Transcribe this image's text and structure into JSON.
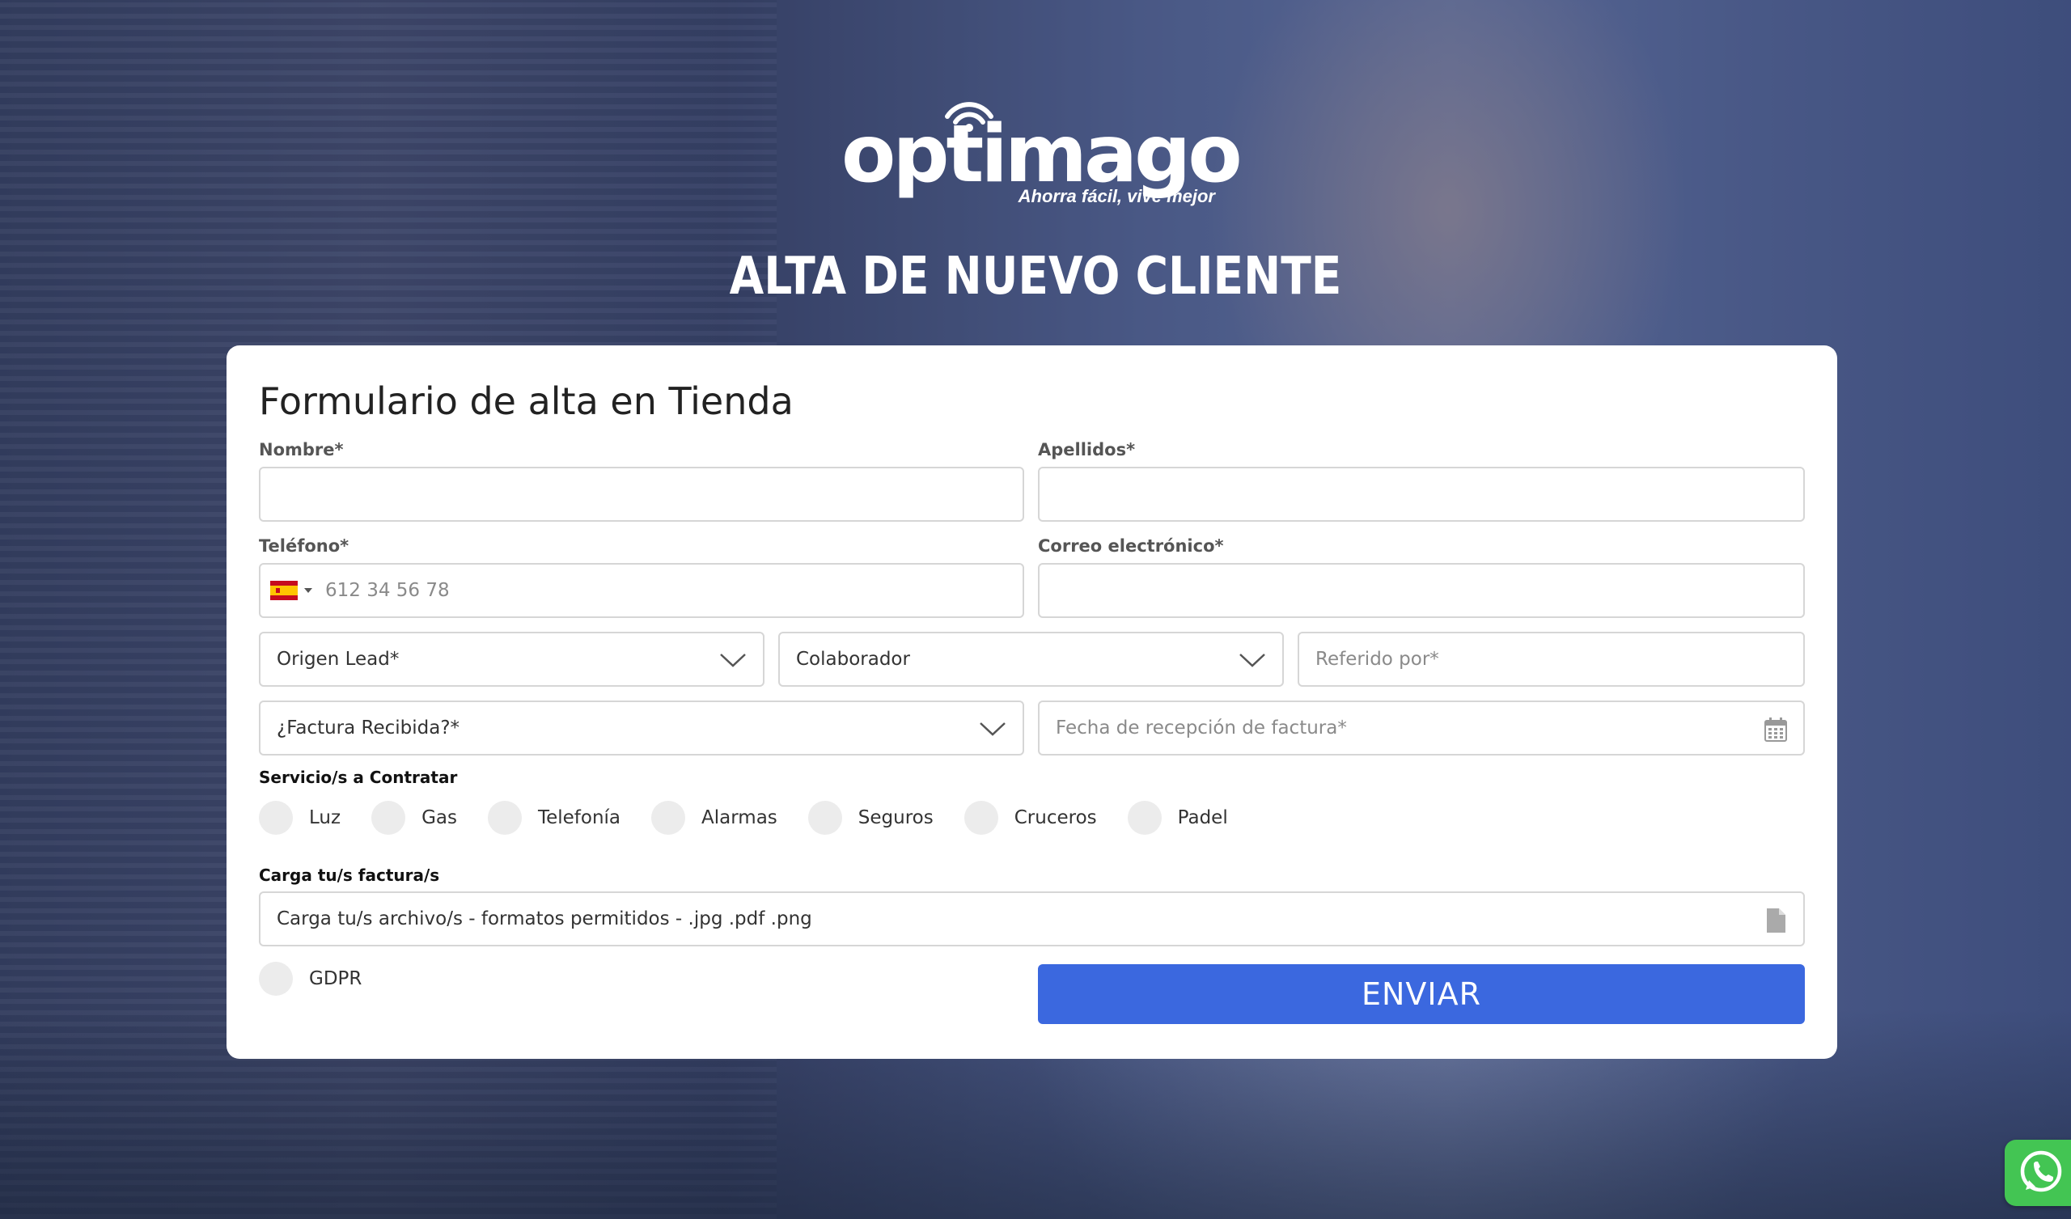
{
  "brand": {
    "logo_text": "optimago",
    "tagline": "Ahorra fácil, vive mejor"
  },
  "page_title": "ALTA DE NUEVO CLIENTE",
  "form": {
    "title": "Formulario de alta en Tienda",
    "nombre": {
      "label": "Nombre*",
      "value": ""
    },
    "apellidos": {
      "label": "Apellidos*",
      "value": ""
    },
    "telefono": {
      "label": "Teléfono*",
      "placeholder": "612 34 56 78",
      "country": "ES"
    },
    "correo": {
      "label": "Correo electrónico*",
      "value": ""
    },
    "origen_lead": {
      "selected": "Origen Lead*"
    },
    "colaborador": {
      "selected": "Colaborador"
    },
    "referido": {
      "placeholder": "Referido por*"
    },
    "factura_recibida": {
      "selected": "¿Factura Recibida?*"
    },
    "fecha_recepcion": {
      "placeholder": "Fecha de recepción de factura*"
    },
    "servicios": {
      "label": "Servicio/s a Contratar",
      "options": [
        "Luz",
        "Gas",
        "Telefonía",
        "Alarmas",
        "Seguros",
        "Cruceros",
        "Padel"
      ]
    },
    "carga": {
      "label": "Carga tu/s factura/s",
      "text": "Carga tu/s archivo/s - formatos permitidos - .jpg .pdf .png"
    },
    "gdpr_label": "GDPR",
    "submit_label": "ENVIAR"
  },
  "colors": {
    "accent": "#3b68df",
    "whatsapp": "#43c553"
  },
  "icons": {
    "select": "chevron-down-icon",
    "date": "calendar-icon",
    "file": "file-icon",
    "chat": "whatsapp-icon"
  }
}
